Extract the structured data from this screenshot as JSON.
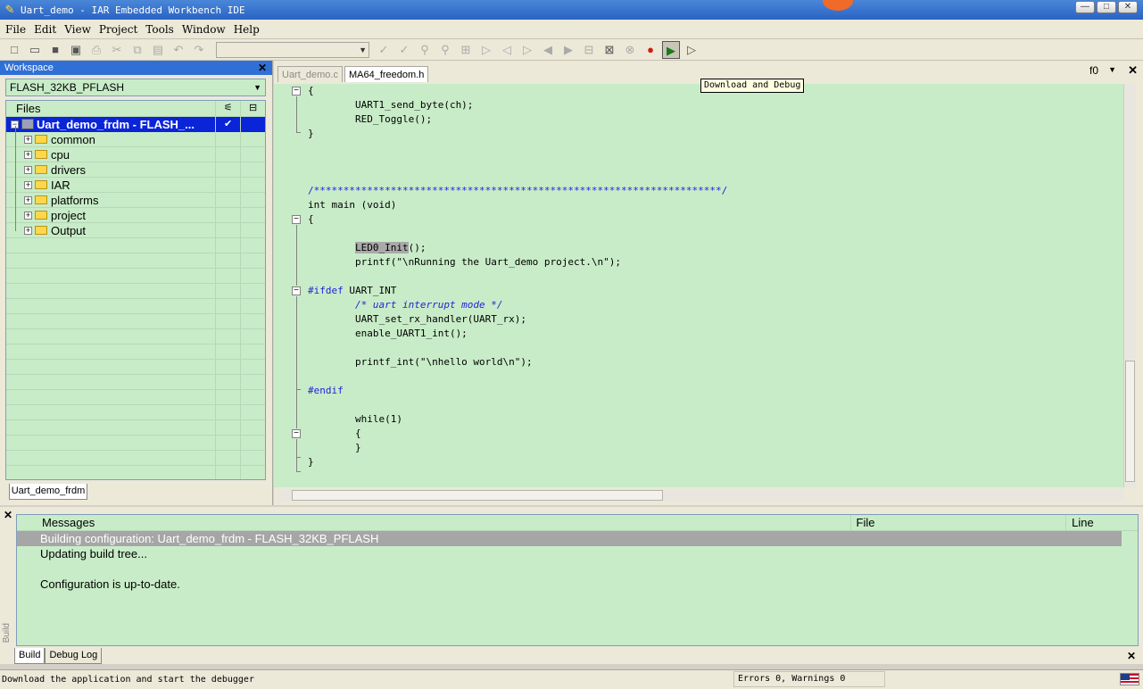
{
  "window": {
    "title": "Uart_demo - IAR Embedded Workbench IDE"
  },
  "menu": [
    "File",
    "Edit",
    "View",
    "Project",
    "Tools",
    "Window",
    "Help"
  ],
  "workspace": {
    "title": "Workspace",
    "configuration": "FLASH_32KB_PFLASH",
    "files_header": "Files",
    "project": "Uart_demo_frdm - FLASH_...",
    "project_check": "✔",
    "folders": [
      "common",
      "cpu",
      "drivers",
      "IAR",
      "platforms",
      "project",
      "Output"
    ],
    "tab": "Uart_demo_frdm"
  },
  "editor": {
    "tabs": [
      "Uart_demo.c",
      "MA64_freedom.h"
    ],
    "function": "f0",
    "tooltip": "Download and Debug",
    "code": [
      {
        "text": "{"
      },
      {
        "text": "        UART1_send_byte(ch);"
      },
      {
        "text": "        RED_Toggle();"
      },
      {
        "text": "}"
      },
      {
        "text": ""
      },
      {
        "text": ""
      },
      {
        "text": ""
      },
      {
        "text": "/*********************************************************************/",
        "style": "blue"
      },
      {
        "text": "int main (void)"
      },
      {
        "text": "{"
      },
      {
        "text": ""
      },
      {
        "text": "        LED0_Init();"
      },
      {
        "text": "        printf(\"\\nRunning the Uart_demo project.\\n\");"
      },
      {
        "text": ""
      },
      {
        "text": "#ifdef UART_INT"
      },
      {
        "text": "        /* uart interrupt mode */",
        "style": "comment"
      },
      {
        "text": "        UART_set_rx_handler(UART_rx);"
      },
      {
        "text": "        enable_UART1_int();"
      },
      {
        "text": ""
      },
      {
        "text": "        printf_int(\"\\nhello world\\n\");"
      },
      {
        "text": ""
      },
      {
        "text": "#endif",
        "style": "blue"
      },
      {
        "text": ""
      },
      {
        "text": "        while(1)"
      },
      {
        "text": "        {"
      },
      {
        "text": "        }"
      },
      {
        "text": "}"
      }
    ]
  },
  "build": {
    "columns": {
      "messages": "Messages",
      "file": "File",
      "line": "Line"
    },
    "rows": [
      "Building configuration: Uart_demo_frdm - FLASH_32KB_PFLASH",
      "Updating build tree...",
      "",
      "Configuration is up-to-date."
    ],
    "tabs": [
      "Build",
      "Debug Log"
    ],
    "side_label": "Build"
  },
  "status": {
    "text": "Download the application and start the debugger",
    "errors": "Errors 0, Warnings 0"
  }
}
